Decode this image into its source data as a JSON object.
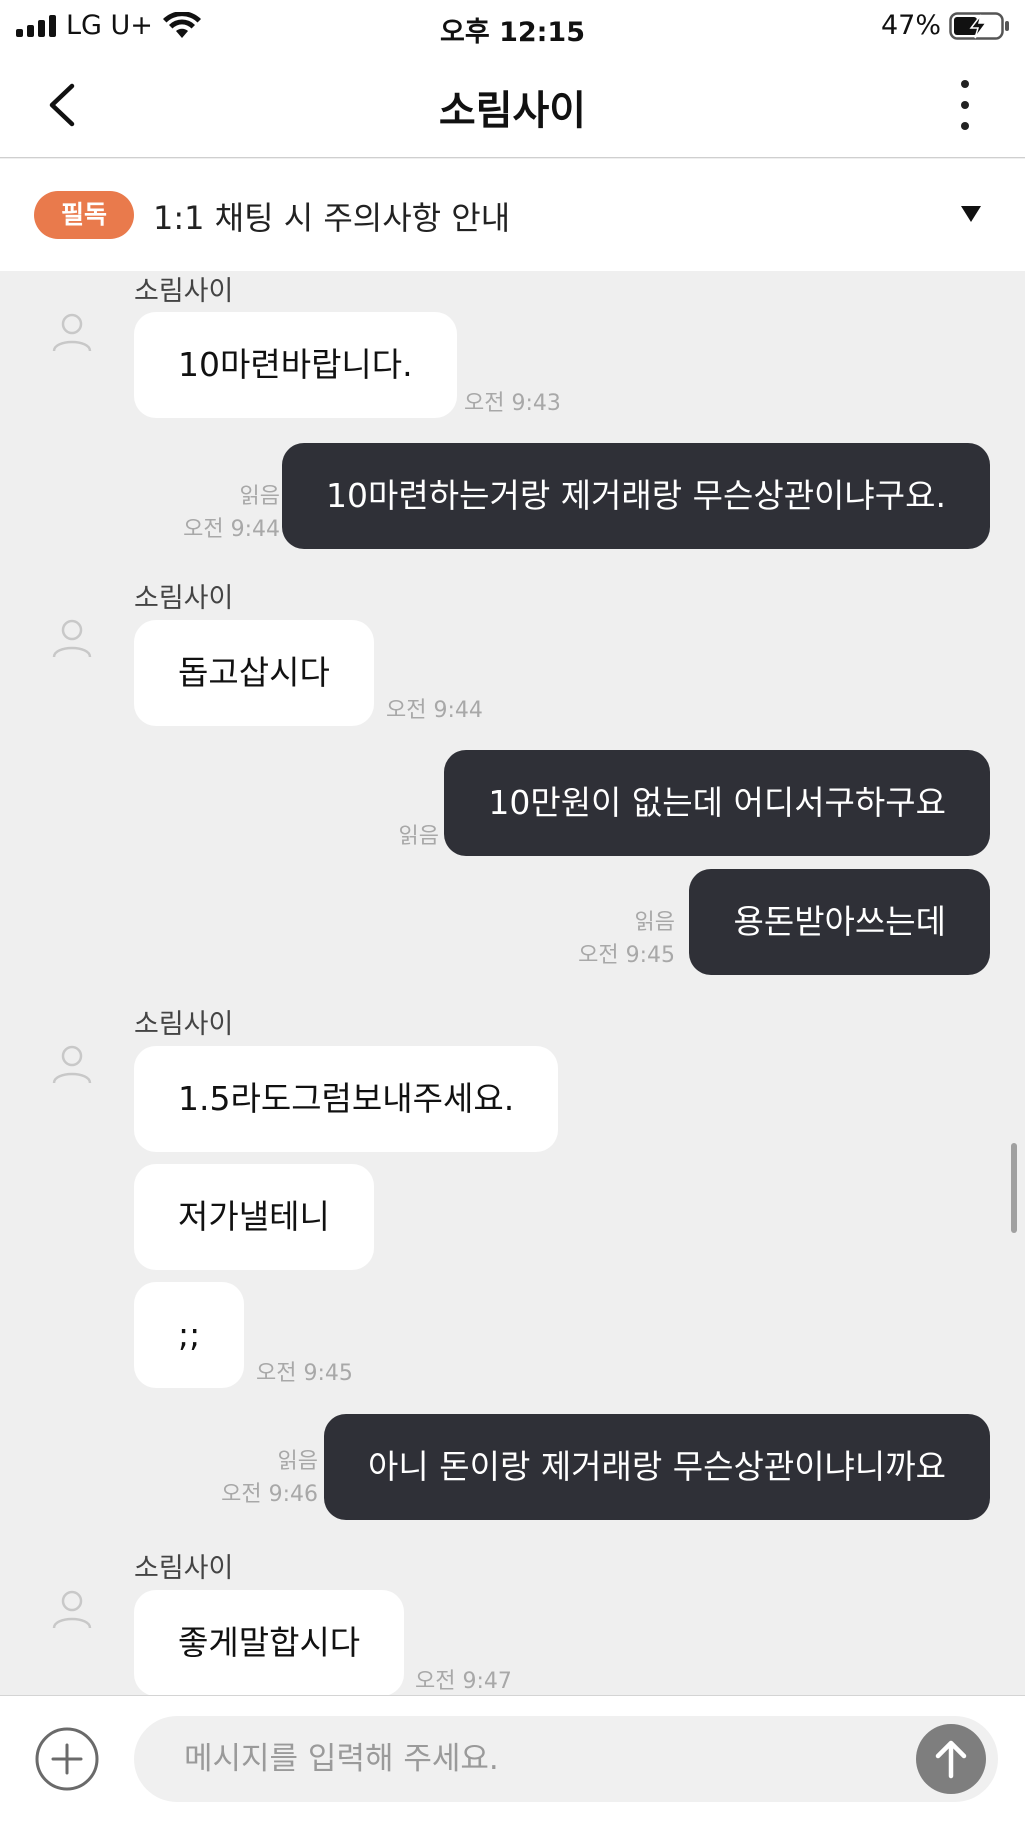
{
  "status_bar": {
    "carrier": "LG U+",
    "time": "오후 12:15",
    "battery": "47%"
  },
  "header": {
    "title": "소림사이"
  },
  "notice": {
    "badge": "필독",
    "text": "1:1 채팅 시 주의사항 안내"
  },
  "messages": [
    {
      "type": "in",
      "sender": "소림사이",
      "text": "10마련바랍니다.",
      "time": "오전 9:43"
    },
    {
      "type": "out",
      "read": "읽음",
      "text": "10마련하는거랑 제거래랑 무슨상관이냐구요.",
      "time": "오전 9:44"
    },
    {
      "type": "in",
      "sender": "소림사이",
      "text": "돕고삽시다",
      "time": "오전 9:44"
    },
    {
      "type": "out",
      "read": "읽음",
      "text": "10만원이 없는데 어디서구하구요",
      "time": ""
    },
    {
      "type": "out",
      "read": "읽음",
      "text": "용돈받아쓰는데",
      "time": "오전 9:45"
    },
    {
      "type": "in",
      "sender": "소림사이",
      "text": "1.5라도그럼보내주세요.",
      "time": ""
    },
    {
      "type": "in",
      "sender": "",
      "text": "저가낼테니",
      "time": ""
    },
    {
      "type": "in",
      "sender": "",
      "text": ";;",
      "time": "오전 9:45"
    },
    {
      "type": "out",
      "read": "읽음",
      "text": "아니 돈이랑 제거래랑 무슨상관이냐니까요",
      "time": "오전 9:46"
    },
    {
      "type": "in",
      "sender": "소림사이",
      "text": "좋게말합시다",
      "time": "오전 9:47"
    }
  ],
  "composer": {
    "placeholder": "메시지를 입력해 주세요."
  },
  "colors": {
    "badge": "#e97a4c",
    "outgoing_bubble": "#2f3037",
    "chat_background": "#efefef"
  }
}
